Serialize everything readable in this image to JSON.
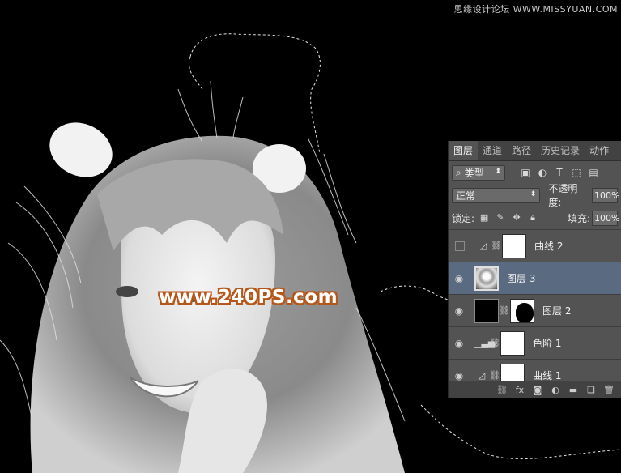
{
  "watermarks": {
    "top": "思缘设计论坛 WWW.MISSYUAN.COM",
    "center": "www.240PS.com"
  },
  "layers_panel": {
    "tabs": [
      {
        "label": "图层",
        "active": true
      },
      {
        "label": "通道",
        "active": false
      },
      {
        "label": "路径",
        "active": false
      },
      {
        "label": "历史记录",
        "active": false
      },
      {
        "label": "动作",
        "active": false
      }
    ],
    "filter": {
      "prefix": "⌕",
      "label": "类型"
    },
    "blend_mode": "正常",
    "opacity_label": "不透明度:",
    "opacity_value": "100%",
    "lock_label": "锁定:",
    "fill_label": "填充:",
    "fill_value": "100%",
    "layers": [
      {
        "name": "曲线 2",
        "visible": false,
        "type": "curves"
      },
      {
        "name": "图层 3",
        "visible": true,
        "type": "image",
        "selected": true
      },
      {
        "name": "图层 2",
        "visible": true,
        "type": "masked"
      },
      {
        "name": "色阶 1",
        "visible": true,
        "type": "levels"
      },
      {
        "name": "曲线 1",
        "visible": true,
        "type": "curves"
      }
    ]
  },
  "colors": {
    "panel_bg": "#535353",
    "selected_layer": "#5a6a80",
    "watermark_outline": "#b5571a"
  }
}
